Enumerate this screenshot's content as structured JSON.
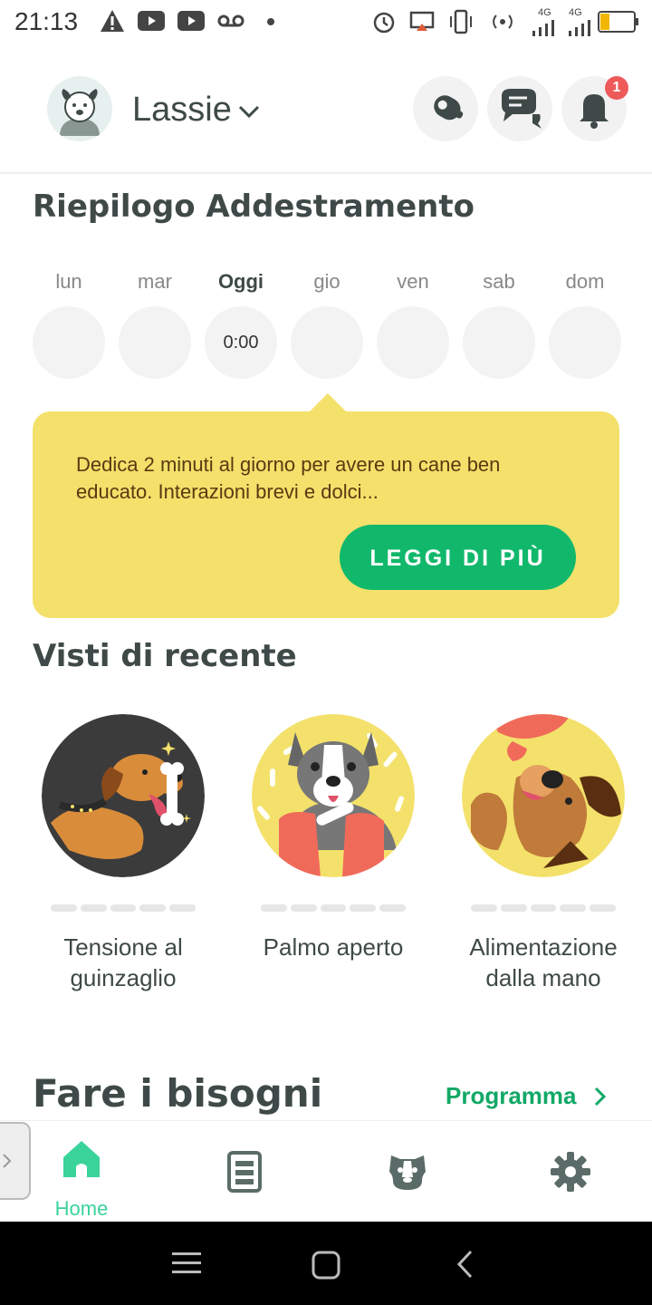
{
  "status_bar": {
    "time": "21:13",
    "icons": [
      "warning-icon",
      "youtube-icon",
      "youtube-icon",
      "voicemail-icon",
      "dot-icon",
      "alarm-icon",
      "cast-icon",
      "vibrate-icon",
      "hotspot-icon",
      "signal-4g-icon",
      "signal-4g-icon",
      "battery-icon"
    ],
    "network_1": "4G",
    "network_2": "4G"
  },
  "header": {
    "dog_name": "Lassie",
    "notification_count": "1",
    "buttons": [
      "clicker-icon",
      "chat-icon",
      "bell-icon"
    ]
  },
  "training_summary": {
    "title": "Riepilogo Addestramento",
    "days": [
      {
        "label": "lun",
        "value": ""
      },
      {
        "label": "mar",
        "value": ""
      },
      {
        "label": "Oggi",
        "value": "0:00"
      },
      {
        "label": "gio",
        "value": ""
      },
      {
        "label": "ven",
        "value": ""
      },
      {
        "label": "sab",
        "value": ""
      },
      {
        "label": "dom",
        "value": ""
      }
    ],
    "tip_text": "Dedica 2 minuti al giorno per avere un cane ben educato. Interazioni brevi e dolci...",
    "tip_button": "LEGGI DI PIÙ"
  },
  "recent": {
    "title": "Visti di recente",
    "items": [
      {
        "title": "Tensione al guinzaglio",
        "progress": 0
      },
      {
        "title": "Palmo aperto",
        "progress": 0
      },
      {
        "title": "Alimentazione dalla mano",
        "progress": 0
      }
    ]
  },
  "potty": {
    "title": "Fare i bisogni",
    "link": "Programma"
  },
  "bottom_nav": {
    "items": [
      {
        "label": "Home",
        "icon": "home-icon",
        "active": true
      },
      {
        "label": "",
        "icon": "lessons-icon",
        "active": false
      },
      {
        "label": "",
        "icon": "dog-icon",
        "active": false
      },
      {
        "label": "",
        "icon": "settings-icon",
        "active": false
      }
    ]
  },
  "colors": {
    "accent": "#11b86c",
    "tip_bg": "#f3e16b",
    "text": "#3f4a48",
    "badge": "#ee5a5a",
    "nav_active": "#3ad39a"
  }
}
